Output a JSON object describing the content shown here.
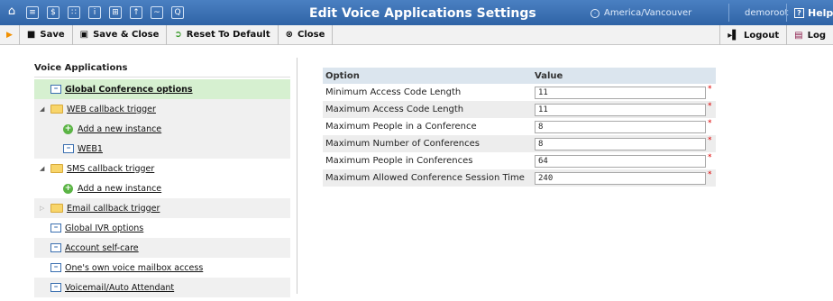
{
  "header": {
    "title": "Edit Voice Applications Settings",
    "timezone": "America/Vancouver",
    "user": "demoroot",
    "help_label": "Help"
  },
  "toolbar": {
    "save_label": "Save",
    "save_close_label": "Save & Close",
    "reset_label": "Reset To Default",
    "close_label": "Close",
    "logout_label": "Logout",
    "log_label": "Log"
  },
  "tree": {
    "heading": "Voice Applications",
    "items": [
      {
        "label": "Global Conference options"
      },
      {
        "label": "WEB callback trigger"
      },
      {
        "label": "Add a new instance"
      },
      {
        "label": "WEB1"
      },
      {
        "label": "SMS callback trigger"
      },
      {
        "label": "Add a new instance"
      },
      {
        "label": "Email callback trigger"
      },
      {
        "label": "Global IVR options"
      },
      {
        "label": "Account self-care"
      },
      {
        "label": "One's own voice mailbox access"
      },
      {
        "label": "Voicemail/Auto Attendant"
      }
    ]
  },
  "table": {
    "col_option": "Option",
    "col_value": "Value",
    "rows": [
      {
        "option": "Minimum Access Code Length",
        "value": "11"
      },
      {
        "option": "Maximum Access Code Length",
        "value": "11"
      },
      {
        "option": "Maximum People in a Conference",
        "value": "8"
      },
      {
        "option": "Maximum Number of Conferences",
        "value": "8"
      },
      {
        "option": "Maximum People in Conferences",
        "value": "64"
      },
      {
        "option": "Maximum Allowed Conference Session Time",
        "value": "240"
      }
    ],
    "required_mark": "*"
  }
}
